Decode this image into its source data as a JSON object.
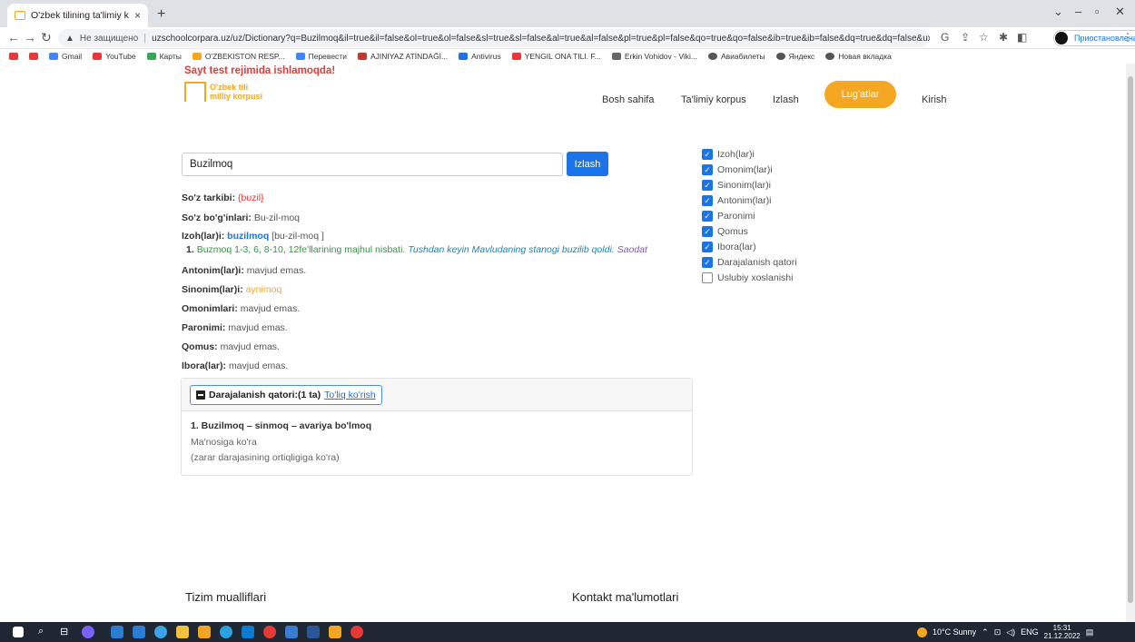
{
  "browser": {
    "tab_title": "O'zbek tilining ta'limiy korpusi",
    "tab_close": "×",
    "new_tab": "+",
    "security_label": "Не защищено",
    "url": "uzschoolcorpara.uz/uz/Dictionary?q=Buzilmoq&il=true&il=false&ol=true&ol=false&sl=true&sl=false&al=true&al=false&pl=true&pl=false&qo=true&qo=false&ib=true&ib=false&dq=true&dq=false&ux=false",
    "profile_status": "Приостановлена",
    "bookmarks": [
      "Gmail",
      "YouTube",
      "Карты",
      "O'ZBEKISTON RESP...",
      "Перевести",
      "AJINIYAZ ATİNDAĞİ...",
      "Antivirus",
      "YENGIL ONA TILI. F...",
      "Erkin Vohidov - Viki...",
      "Авиабилеты",
      "Яндекс",
      "Новая вкладка"
    ]
  },
  "site": {
    "banner": "Sayt test rejimida ishlamoqda!",
    "logo_line1": "O'zbek tili",
    "logo_line2": "milliy korpusi",
    "nav": {
      "home": "Bosh sahifa",
      "corpus": "Ta'limiy korpus",
      "search": "Izlash",
      "dictionaries": "Lug'atlar",
      "login": "Kirish"
    }
  },
  "search": {
    "value": "Buzilmoq",
    "button": "Izlash"
  },
  "result": {
    "tarkibi_label": "So'z tarkibi:",
    "tarkibi_value": "{buzil}",
    "bogin_label": "So'z bo'g'inlari:",
    "bogin_value": "Bu-zil-moq",
    "izoh_label": "Izoh(lar)i:",
    "izoh_word": "buzilmoq",
    "izoh_transcription": "[bu-zil-moq ]",
    "izoh_def_num": "1.",
    "izoh_def": "Buzmoq 1-3, 6, 8-10, 12fe'llarining majhul nisbati.",
    "izoh_example": "Tushdan keyin Mavludaning stanogi buzilib qoldi.",
    "izoh_source": "Saodat",
    "antonim_label": "Antonim(lar)i:",
    "antonim_value": "mavjud emas.",
    "sinonim_label": "Sinonim(lar)i:",
    "sinonim_value": "aynimoq",
    "omonim_label": "Omonimlari:",
    "omonim_value": "mavjud emas.",
    "paronim_label": "Paronimi:",
    "paronim_value": "mavjud emas.",
    "qomus_label": "Qomus:",
    "qomus_value": "mavjud emas.",
    "ibora_label": "Ibora(lar):",
    "ibora_value": "mavjud emas."
  },
  "gradation": {
    "title": "Darajalanish qatori:(1 ta)",
    "link": "To'liq ko'rish",
    "item": "1. Buzilmoq – sinmoq – avariya bo'lmoq",
    "meaning": "Ma'nosiga ko'ra",
    "note": "(zarar darajasining ortiqligiga ko'ra)"
  },
  "filters": [
    {
      "label": "Izoh(lar)i",
      "checked": true
    },
    {
      "label": "Omonim(lar)i",
      "checked": true
    },
    {
      "label": "Sinonim(lar)i",
      "checked": true
    },
    {
      "label": "Antonim(lar)i",
      "checked": true
    },
    {
      "label": "Paronimi",
      "checked": true
    },
    {
      "label": "Qomus",
      "checked": true
    },
    {
      "label": "Ibora(lar)",
      "checked": true
    },
    {
      "label": "Darajalanish qatori",
      "checked": true
    },
    {
      "label": "Uslubiy xoslanishi",
      "checked": false
    }
  ],
  "footer": {
    "authors": "Tizim mualliflari",
    "contacts": "Kontakt ma'lumotlari"
  },
  "taskbar": {
    "weather": "10°C Sunny",
    "lang": "ENG",
    "time": "15:31",
    "date": "21.12.2022"
  },
  "colors": {
    "accent": "#f5a623",
    "primary": "#1a73e8",
    "danger": "#e53935"
  }
}
